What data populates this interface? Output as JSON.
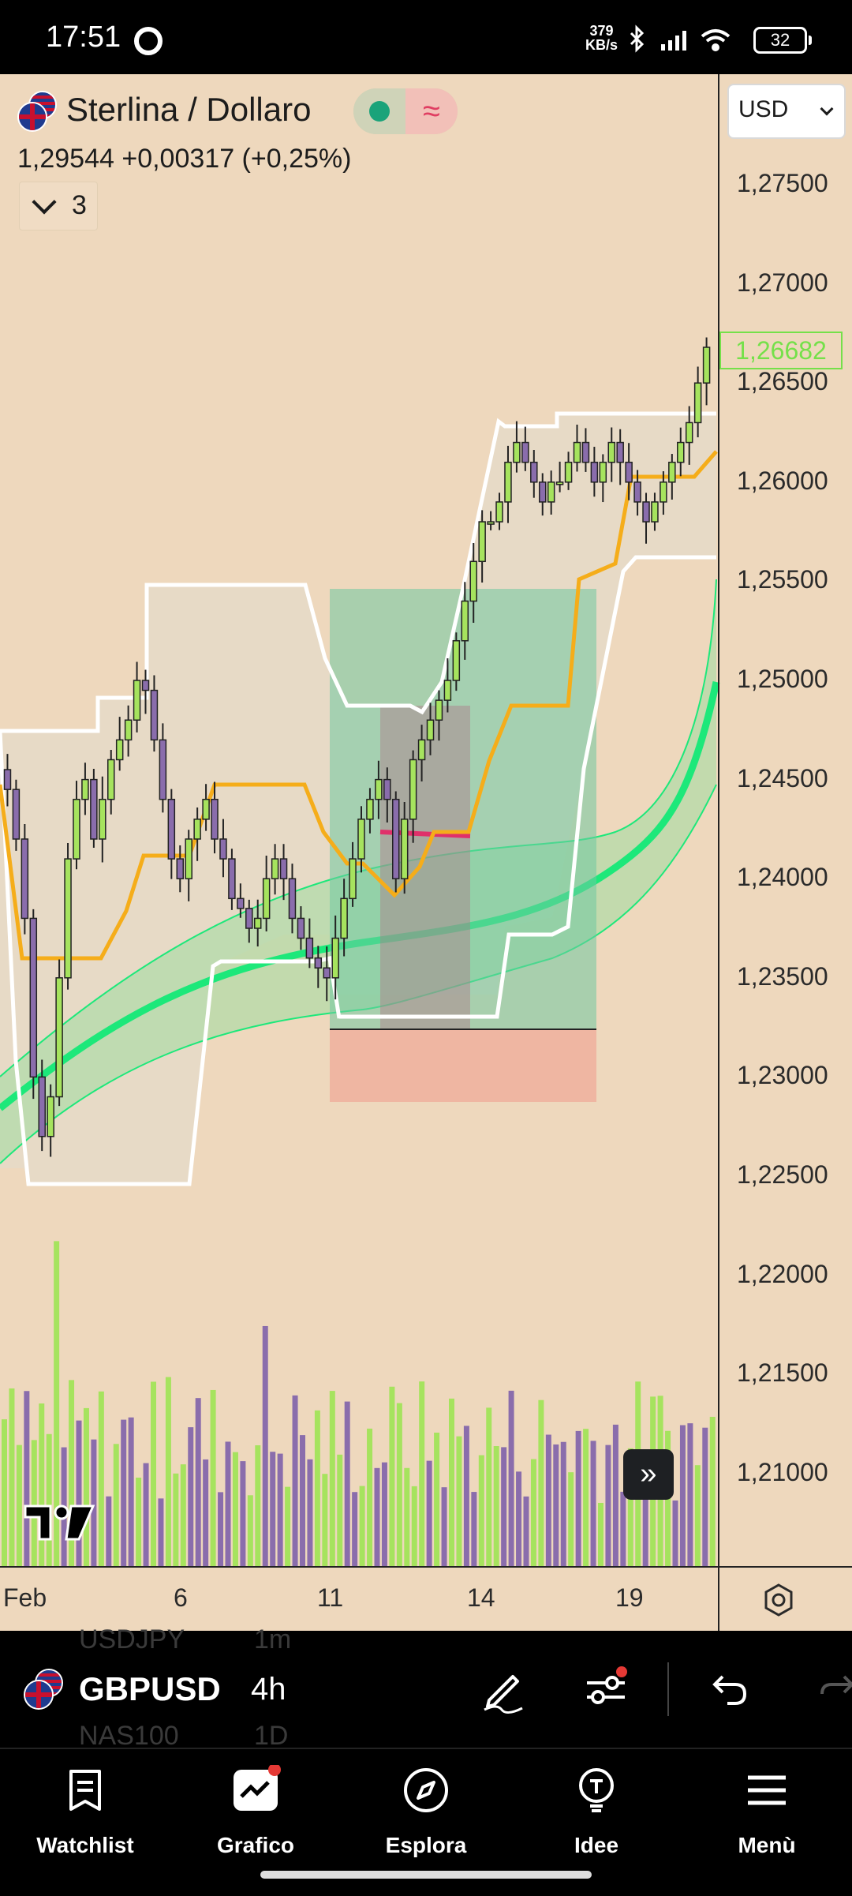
{
  "status_bar": {
    "time": "17:51",
    "speed_value": "379",
    "speed_unit": "KB/s",
    "battery": "32"
  },
  "chart": {
    "symbol_name": "Sterlina / Dollaro",
    "price_line": "1,29544  +0,00317 (+0,25%)",
    "indicators_count": "3",
    "currency": "USD",
    "last_price": "1,26682",
    "price_axis": [
      "1,27500",
      "1,27000",
      "1,26500",
      "1,26000",
      "1,25500",
      "1,25000",
      "1,24500",
      "1,24000",
      "1,23500",
      "1,23000",
      "1,22500",
      "1,22000",
      "1,21500",
      "1,21000"
    ],
    "time_axis": [
      "Feb",
      "6",
      "11",
      "14",
      "19"
    ],
    "colors": {
      "background": "#eed8bd",
      "up_candle": "#a6e35e",
      "down_candle": "#8a6dac",
      "ma_main": "#1de87a",
      "conversion_line": "#f5ad1a",
      "channel_line": "#ffffff"
    }
  },
  "symbol_bar": {
    "prev_symbol": "USDJPY",
    "prev_interval": "1m",
    "symbol": "GBPUSD",
    "interval": "4h",
    "next_symbol": "NAS100",
    "next_interval": "1D",
    "icons": [
      "pencil-icon",
      "sliders-icon",
      "undo-icon",
      "redo-icon"
    ]
  },
  "nav": {
    "items": [
      "Watchlist",
      "Grafico",
      "Esplora",
      "Idee",
      "Menù"
    ]
  }
}
